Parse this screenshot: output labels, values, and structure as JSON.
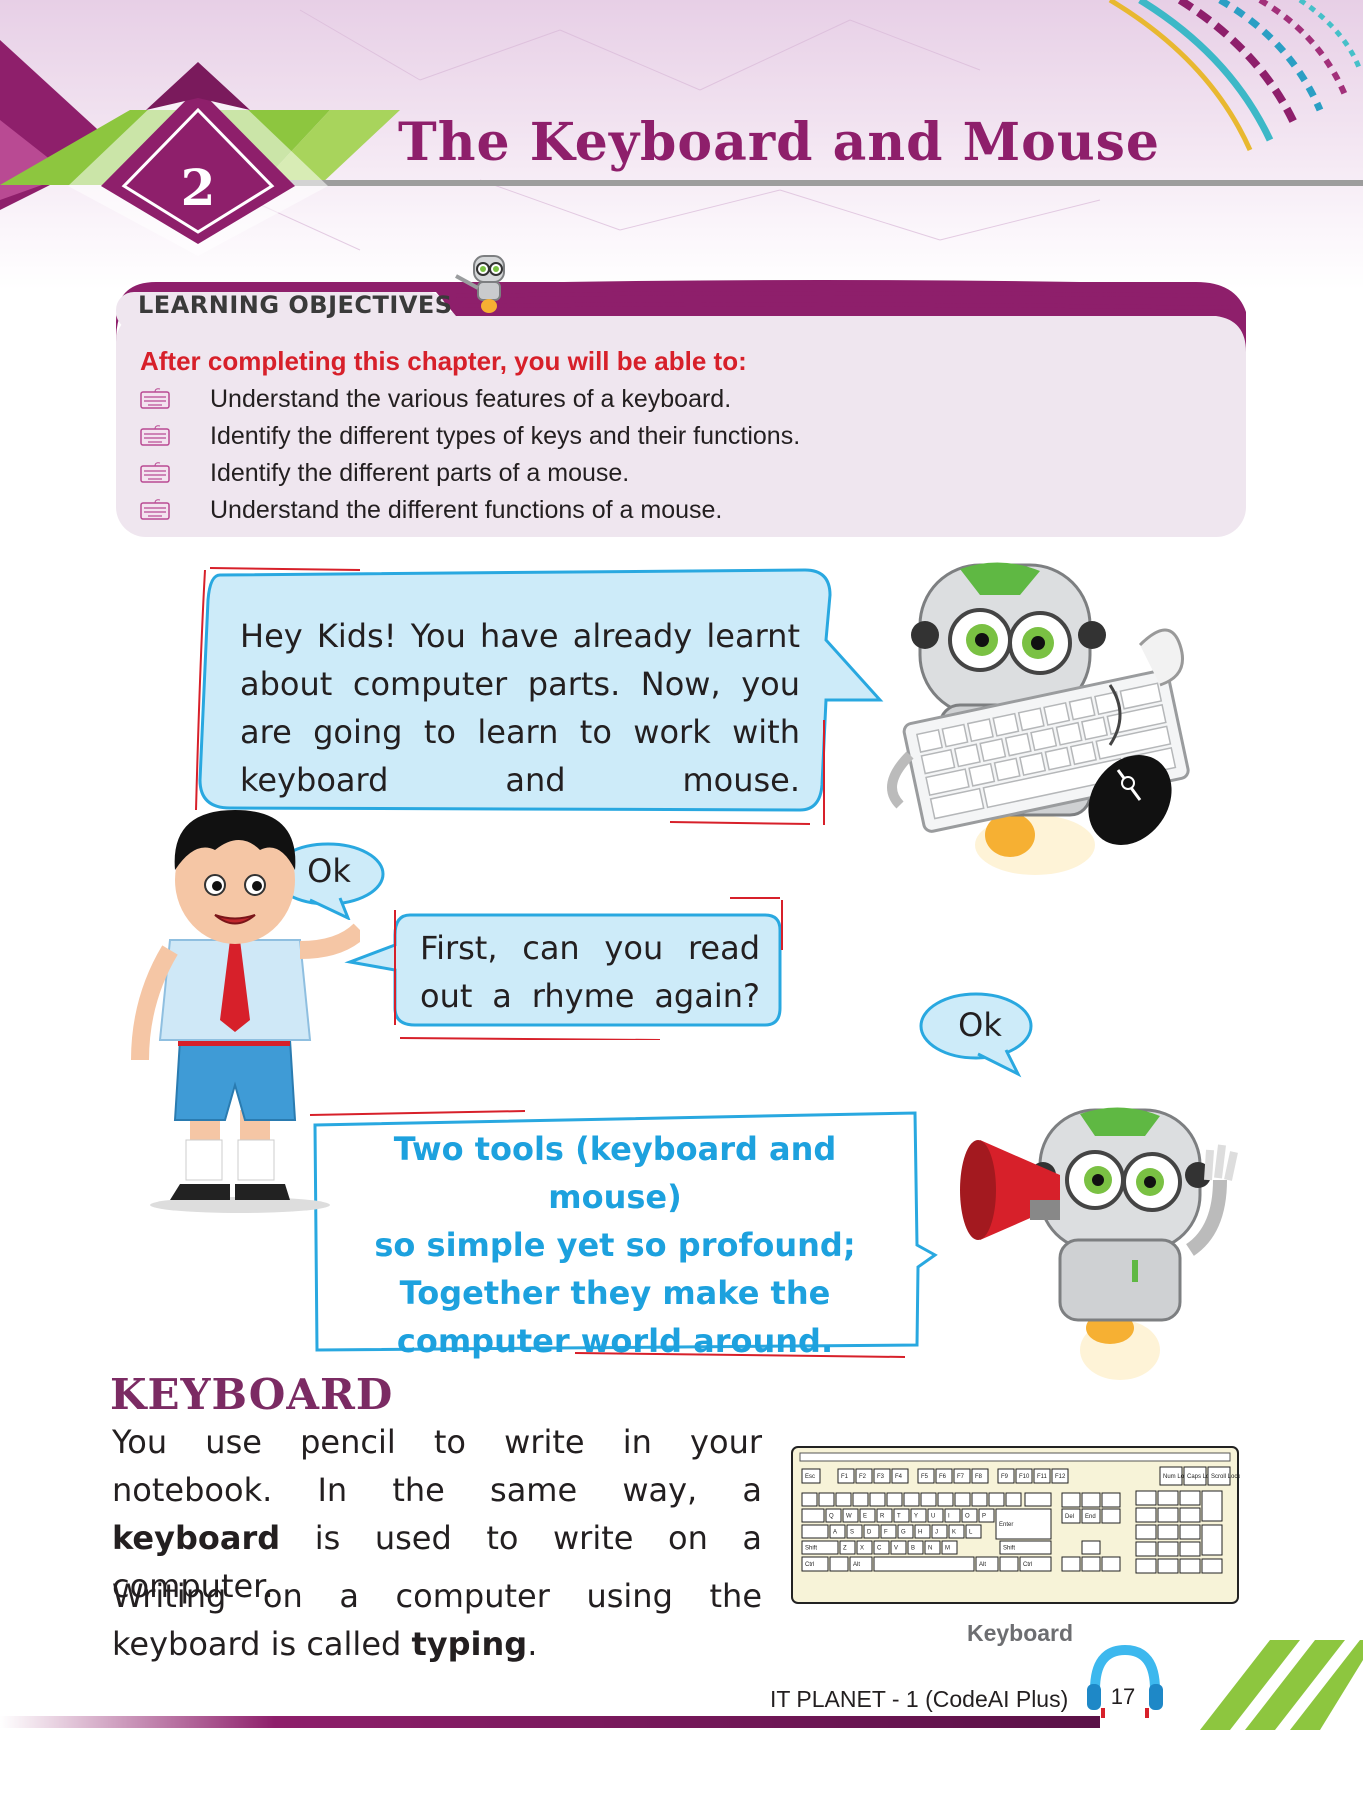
{
  "chapter": {
    "number": "2",
    "title": "The Keyboard and Mouse"
  },
  "learning_objectives": {
    "heading": "LEARNING OBJECTIVES",
    "intro": "After completing this chapter, you will be able to:",
    "items": [
      "Understand the various features of a keyboard.",
      "Identify the different types of keys and their functions.",
      "Identify the different parts of a mouse.",
      "Understand the different functions of a mouse."
    ]
  },
  "dialogue": {
    "robot_bubble": "Hey Kids! You have already learnt about computer parts. Now, you are going to learn to work with keyboard and mouse.",
    "boy_reply": "Ok",
    "robot_question": "First, can you read out a rhyme again?",
    "robot_reply": "Ok",
    "rhyme": [
      "Two tools (keyboard and mouse)",
      "so simple yet so profound;",
      "Together they make the",
      "computer world around."
    ]
  },
  "keyboard_section": {
    "heading": "KEYBOARD",
    "para1_a": "You use pencil to write in your notebook. In the same way, a ",
    "para1_bold": "keyboard",
    "para1_b": " is used to write on a computer.",
    "para2_a": "Writing on a computer using the keyboard is called ",
    "para2_bold": "typing",
    "para2_b": ".",
    "image_caption": "Keyboard"
  },
  "footer": {
    "book_title": "IT PLANET - 1 (CodeAI Plus)",
    "page_number": "17"
  },
  "colors": {
    "title_purple": "#8e1f6b",
    "accent_green": "#8dc63f",
    "objective_red": "#d7202a",
    "rhyme_blue": "#1da1de",
    "bubble_fill": "#cdebf9"
  },
  "keyboard_keys": {
    "function_row": [
      "Esc",
      "F1",
      "F2",
      "F3",
      "F4",
      "F5",
      "F6",
      "F7",
      "F8",
      "F9",
      "F10",
      "F11",
      "F12"
    ],
    "lock_keys": [
      "Num Lock",
      "Caps Lock",
      "Scroll Lock"
    ],
    "row_q": [
      "Q",
      "W",
      "E",
      "R",
      "T",
      "Y",
      "U",
      "I",
      "O",
      "P"
    ],
    "row_a": [
      "A",
      "S",
      "D",
      "F",
      "G",
      "H",
      "J",
      "K",
      "L"
    ],
    "row_z": [
      "Z",
      "X",
      "C",
      "V",
      "B",
      "N",
      "M"
    ],
    "special": [
      "Enter",
      "Shift",
      "Ctrl",
      "Alt",
      "Del",
      "End"
    ]
  }
}
